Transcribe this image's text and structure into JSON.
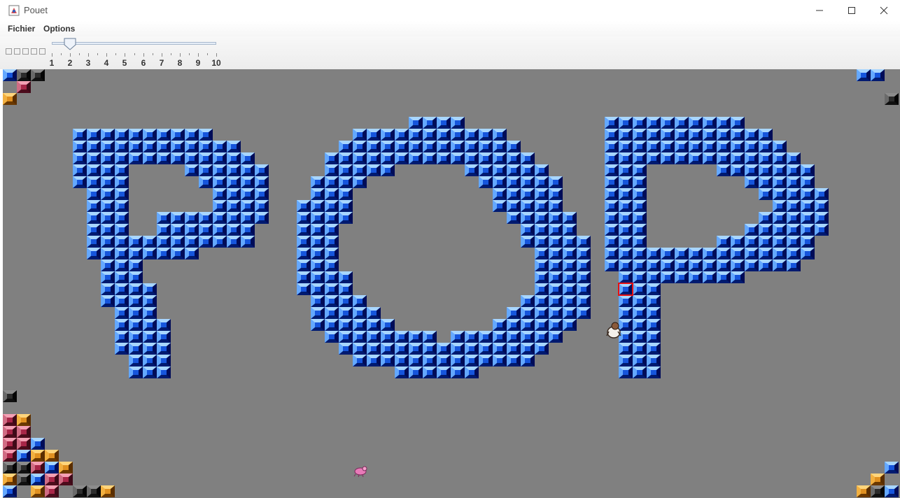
{
  "window": {
    "title": "Pouet",
    "controls": [
      "minimize-icon",
      "maximize-icon",
      "close-icon"
    ]
  },
  "menu": {
    "items": [
      "Fichier",
      "Options"
    ]
  },
  "toolbar": {
    "mini_boxes": 5,
    "slider": {
      "min": 1,
      "max": 10,
      "value": 2,
      "tick_labels": [
        "1",
        "2",
        "3",
        "4",
        "5",
        "6",
        "7",
        "8",
        "9",
        "10"
      ]
    }
  },
  "colors": {
    "board_bg": "#808080",
    "blue": "#1655dc",
    "black": "#2c2c2c",
    "orange": "#e09020",
    "red": "#a82648",
    "selection": "#e81010"
  },
  "board": {
    "word": "POP",
    "grid": {
      "cols": 64,
      "rows": 36
    },
    "cursor_cell": [
      44,
      18
    ],
    "letters": [
      {
        "name": "letter-p-1",
        "rows": [
          [
            5,
            [
              5,
              14
            ]
          ],
          [
            6,
            [
              5,
              16
            ]
          ],
          [
            7,
            [
              5,
              17
            ]
          ],
          [
            8,
            [
              5,
              8
            ],
            [
              13,
              18
            ]
          ],
          [
            9,
            [
              5,
              8
            ],
            [
              14,
              18
            ]
          ],
          [
            10,
            [
              6,
              8
            ],
            [
              15,
              18
            ]
          ],
          [
            11,
            [
              6,
              8
            ],
            [
              15,
              18
            ]
          ],
          [
            12,
            [
              6,
              8
            ],
            [
              11,
              18
            ]
          ],
          [
            13,
            [
              6,
              8
            ],
            [
              11,
              17
            ]
          ],
          [
            14,
            [
              6,
              17
            ]
          ],
          [
            15,
            [
              6,
              13
            ]
          ],
          [
            16,
            [
              7,
              9
            ]
          ],
          [
            17,
            [
              7,
              9
            ]
          ],
          [
            18,
            [
              7,
              10
            ]
          ],
          [
            19,
            [
              7,
              10
            ]
          ],
          [
            20,
            [
              8,
              10
            ]
          ],
          [
            21,
            [
              8,
              11
            ]
          ],
          [
            22,
            [
              8,
              11
            ]
          ],
          [
            23,
            [
              8,
              11
            ]
          ],
          [
            24,
            [
              9,
              11
            ]
          ],
          [
            25,
            [
              9,
              11
            ]
          ]
        ]
      },
      {
        "name": "letter-o",
        "rows": [
          [
            4,
            [
              29,
              32
            ]
          ],
          [
            5,
            [
              25,
              35
            ]
          ],
          [
            6,
            [
              24,
              36
            ]
          ],
          [
            7,
            [
              23,
              37
            ]
          ],
          [
            8,
            [
              23,
              27
            ],
            [
              33,
              38
            ]
          ],
          [
            9,
            [
              22,
              25
            ],
            [
              34,
              39
            ]
          ],
          [
            10,
            [
              22,
              24
            ],
            [
              35,
              39
            ]
          ],
          [
            11,
            [
              21,
              24
            ],
            [
              35,
              39
            ]
          ],
          [
            12,
            [
              21,
              24
            ],
            [
              36,
              40
            ]
          ],
          [
            13,
            [
              21,
              23
            ],
            [
              37,
              40
            ]
          ],
          [
            14,
            [
              21,
              23
            ],
            [
              37,
              41
            ]
          ],
          [
            15,
            [
              21,
              23
            ],
            [
              38,
              41
            ]
          ],
          [
            16,
            [
              21,
              23
            ],
            [
              38,
              41
            ]
          ],
          [
            17,
            [
              21,
              24
            ],
            [
              38,
              41
            ]
          ],
          [
            18,
            [
              21,
              24
            ],
            [
              38,
              41
            ]
          ],
          [
            19,
            [
              22,
              25
            ],
            [
              37,
              41
            ]
          ],
          [
            20,
            [
              22,
              26
            ],
            [
              36,
              41
            ]
          ],
          [
            21,
            [
              22,
              27
            ],
            [
              35,
              40
            ]
          ],
          [
            22,
            [
              23,
              30
            ],
            [
              32,
              39
            ]
          ],
          [
            23,
            [
              24,
              38
            ]
          ],
          [
            24,
            [
              25,
              37
            ]
          ],
          [
            25,
            [
              28,
              33
            ]
          ]
        ]
      },
      {
        "name": "letter-p-2",
        "rows": [
          [
            4,
            [
              43,
              52
            ]
          ],
          [
            5,
            [
              43,
              54
            ]
          ],
          [
            6,
            [
              43,
              55
            ]
          ],
          [
            7,
            [
              43,
              56
            ]
          ],
          [
            8,
            [
              43,
              45
            ],
            [
              51,
              57
            ]
          ],
          [
            9,
            [
              43,
              45
            ],
            [
              53,
              57
            ]
          ],
          [
            10,
            [
              43,
              45
            ],
            [
              54,
              58
            ]
          ],
          [
            11,
            [
              43,
              45
            ],
            [
              55,
              58
            ]
          ],
          [
            12,
            [
              43,
              45
            ],
            [
              54,
              58
            ]
          ],
          [
            13,
            [
              43,
              45
            ],
            [
              53,
              58
            ]
          ],
          [
            14,
            [
              43,
              45
            ],
            [
              51,
              57
            ]
          ],
          [
            15,
            [
              43,
              57
            ]
          ],
          [
            16,
            [
              43,
              56
            ]
          ],
          [
            17,
            [
              44,
              52
            ]
          ],
          [
            18,
            [
              44,
              46
            ]
          ],
          [
            19,
            [
              44,
              46
            ]
          ],
          [
            20,
            [
              44,
              46
            ]
          ],
          [
            21,
            [
              44,
              46
            ]
          ],
          [
            22,
            [
              44,
              46
            ]
          ],
          [
            23,
            [
              44,
              46
            ]
          ],
          [
            24,
            [
              44,
              46
            ]
          ],
          [
            25,
            [
              44,
              46
            ]
          ]
        ]
      }
    ],
    "corner_blocks": [
      [
        0,
        0,
        "blue"
      ],
      [
        1,
        0,
        "black"
      ],
      [
        2,
        0,
        "black"
      ],
      [
        1,
        1,
        "red"
      ],
      [
        0,
        2,
        "orange"
      ],
      [
        61,
        0,
        "blue"
      ],
      [
        62,
        0,
        "blue"
      ],
      [
        63,
        2,
        "black"
      ],
      [
        0,
        27,
        "black"
      ],
      [
        0,
        29,
        "red"
      ],
      [
        1,
        29,
        "orange"
      ],
      [
        0,
        30,
        "red"
      ],
      [
        1,
        30,
        "red"
      ],
      [
        0,
        31,
        "red"
      ],
      [
        1,
        31,
        "red"
      ],
      [
        2,
        31,
        "blue"
      ],
      [
        0,
        32,
        "red"
      ],
      [
        1,
        32,
        "blue"
      ],
      [
        2,
        32,
        "orange"
      ],
      [
        3,
        32,
        "orange"
      ],
      [
        0,
        33,
        "black"
      ],
      [
        1,
        33,
        "black"
      ],
      [
        2,
        33,
        "red"
      ],
      [
        3,
        33,
        "blue"
      ],
      [
        4,
        33,
        "orange"
      ],
      [
        0,
        34,
        "orange"
      ],
      [
        1,
        34,
        "black"
      ],
      [
        2,
        34,
        "blue"
      ],
      [
        3,
        34,
        "red"
      ],
      [
        4,
        34,
        "red"
      ],
      [
        0,
        35,
        "blue"
      ],
      [
        2,
        35,
        "orange"
      ],
      [
        3,
        35,
        "red"
      ],
      [
        5,
        35,
        "black"
      ],
      [
        6,
        35,
        "black"
      ],
      [
        7,
        35,
        "orange"
      ],
      [
        63,
        33,
        "blue"
      ],
      [
        62,
        34,
        "orange"
      ],
      [
        61,
        35,
        "orange"
      ],
      [
        62,
        35,
        "black"
      ],
      [
        63,
        35,
        "blue"
      ]
    ]
  }
}
